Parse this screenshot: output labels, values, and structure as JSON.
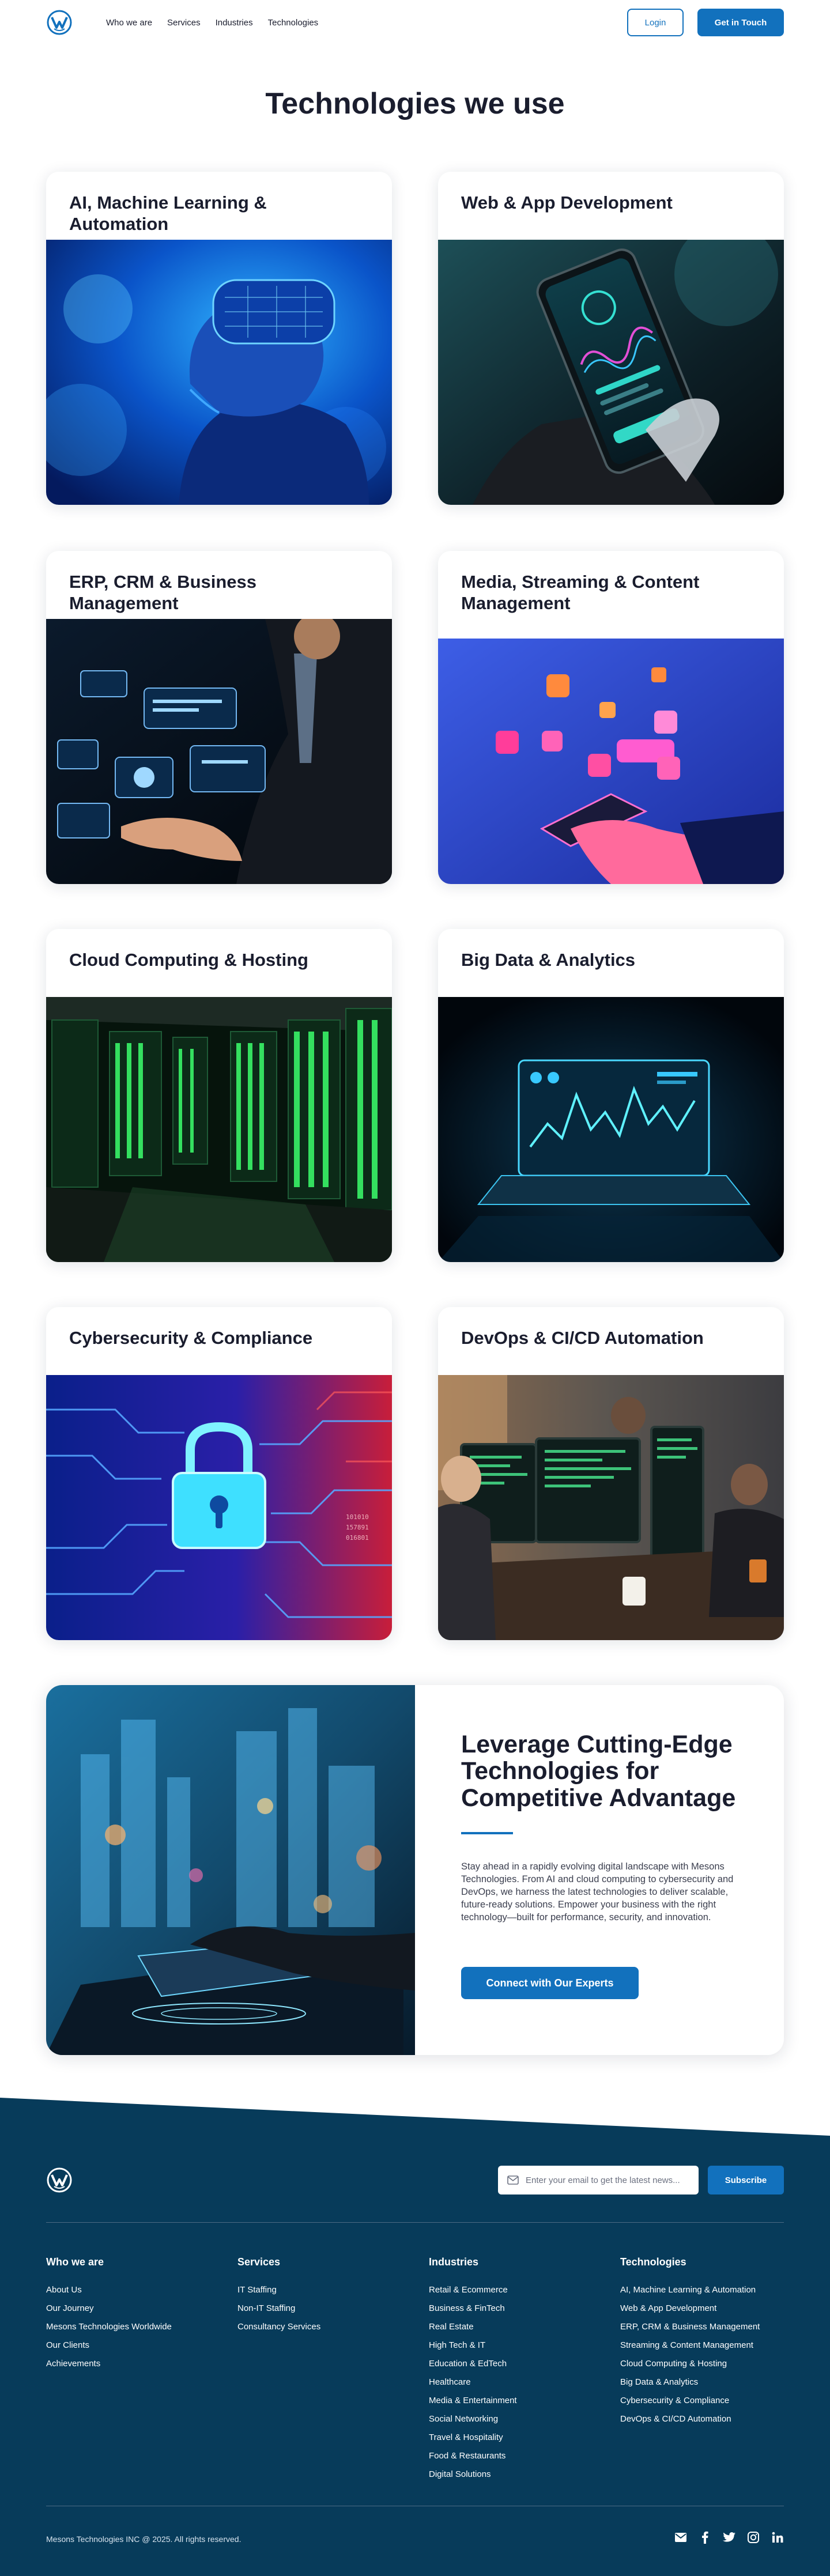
{
  "header": {
    "nav": [
      "Who we are",
      "Services",
      "Industries",
      "Technologies"
    ],
    "login_label": "Login",
    "cta_label": "Get in Touch"
  },
  "page_title": "Technologies we use",
  "cards": [
    {
      "title": "AI, Machine Learning & Automation"
    },
    {
      "title": "Web & App Development"
    },
    {
      "title": "ERP, CRM & Business Management"
    },
    {
      "title": "Media, Streaming & Content Management"
    },
    {
      "title": "Cloud Computing & Hosting"
    },
    {
      "title": "Big Data & Analytics"
    },
    {
      "title": "Cybersecurity & Compliance"
    },
    {
      "title": "DevOps & CI/CD Automation"
    }
  ],
  "leverage": {
    "title": "Leverage Cutting-Edge Technologies for Competitive Advantage",
    "text": "Stay ahead in a rapidly evolving digital landscape with Mesons Technologies. From AI and cloud computing to cybersecurity and DevOps, we harness the latest technologies to deliver scalable, future-ready solutions. Empower your business with the right technology—built for performance, security, and innovation.",
    "button_label": "Connect with Our Experts"
  },
  "footer": {
    "newsletter_placeholder": "Enter your email to get the latest news...",
    "subscribe_label": "Subscribe",
    "columns": [
      {
        "heading": "Who we are",
        "items": [
          "About Us",
          "Our Journey",
          "Mesons Technologies Worldwide",
          "Our Clients",
          "Achievements"
        ]
      },
      {
        "heading": "Services",
        "items": [
          "IT Staffing",
          "Non-IT Staffing",
          "Consultancy Services"
        ]
      },
      {
        "heading": "Industries",
        "items": [
          "Retail & Ecommerce",
          "Business & FinTech",
          "Real Estate",
          "High Tech & IT",
          "Education & EdTech",
          "Healthcare",
          "Media & Entertainment",
          "Social Networking",
          "Travel & Hospitality",
          "Food & Restaurants",
          "Digital Solutions"
        ]
      },
      {
        "heading": "Technologies",
        "items": [
          "AI, Machine Learning & Automation",
          "Web & App Development",
          "ERP, CRM & Business Management",
          "Streaming & Content Management",
          "Cloud Computing & Hosting",
          "Big Data & Analytics",
          "Cybersecurity & Compliance",
          "DevOps & CI/CD Automation"
        ]
      }
    ],
    "copyright": "Mesons Technologies INC @ 2025. All rights reserved.",
    "socials": [
      "mail-icon",
      "facebook-icon",
      "twitter-icon",
      "instagram-icon",
      "linkedin-icon"
    ]
  },
  "colors": {
    "brand_blue": "#1271bd",
    "footer_navy": "#073b5a",
    "heading": "#1a1d2e"
  }
}
